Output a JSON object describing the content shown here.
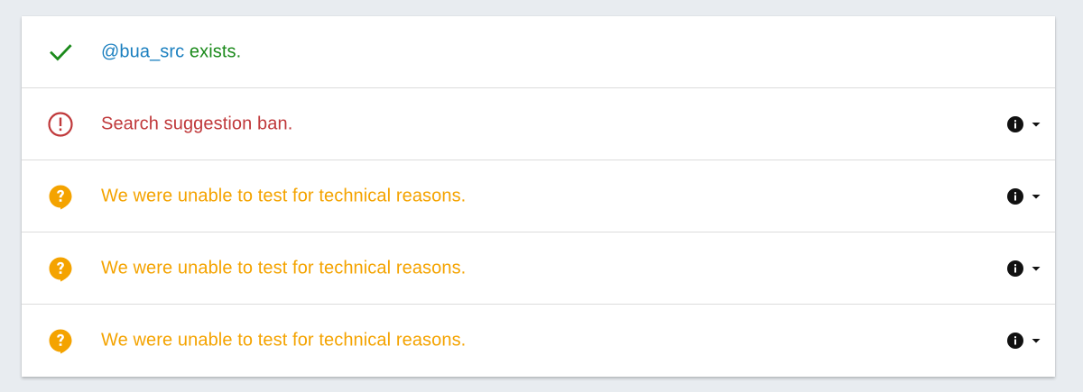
{
  "results": [
    {
      "status": "ok",
      "icon": "check-icon",
      "handle": "@bua_src",
      "text": " exists.",
      "has_details": false
    },
    {
      "status": "ban",
      "icon": "alert-circle-icon",
      "text": "Search suggestion ban.",
      "has_details": true
    },
    {
      "status": "unknown",
      "icon": "question-bubble-icon",
      "text": "We were unable to test for technical reasons.",
      "has_details": true
    },
    {
      "status": "unknown",
      "icon": "question-bubble-icon",
      "text": "We were unable to test for technical reasons.",
      "has_details": true
    },
    {
      "status": "unknown",
      "icon": "question-bubble-icon",
      "text": "We were unable to test for technical reasons.",
      "has_details": true
    }
  ],
  "details_icons": {
    "info": "info-icon",
    "toggle": "caret-down-icon"
  },
  "colors": {
    "handle": "#1a7fbf",
    "ok": "#1b8a1b",
    "ban": "#c0393b",
    "unknown": "#f4a300",
    "background": "#e8ecf0",
    "card": "#ffffff"
  }
}
